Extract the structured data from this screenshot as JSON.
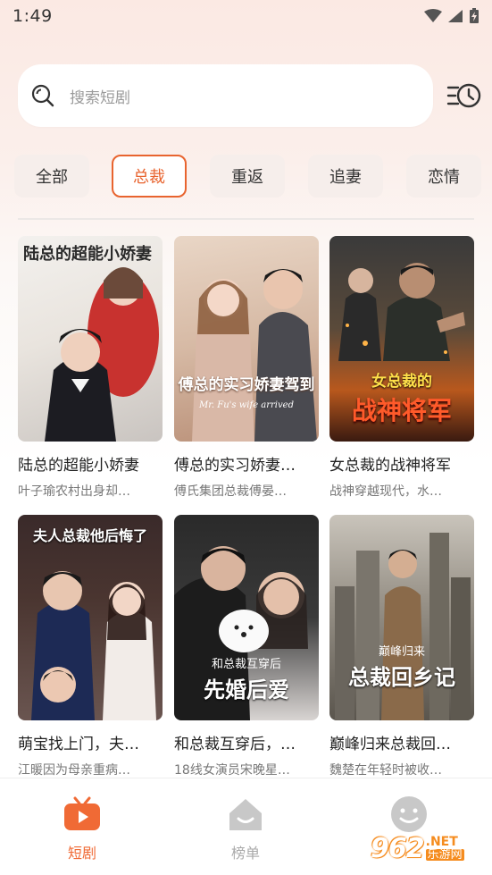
{
  "status_bar": {
    "time": "1:49"
  },
  "search": {
    "placeholder": "搜索短剧"
  },
  "tabs": [
    {
      "label": "全部",
      "active": false
    },
    {
      "label": "总裁",
      "active": true
    },
    {
      "label": "重返",
      "active": false
    },
    {
      "label": "追妻",
      "active": false
    },
    {
      "label": "恋情",
      "active": false
    }
  ],
  "cards": [
    {
      "title": "陆总的超能小娇妻",
      "desc": "叶子瑜农村出身却…",
      "poster_text": "陆总的超能小娇妻"
    },
    {
      "title": "傅总的实习娇妻…",
      "desc": "傅氏集团总裁傅晏…",
      "poster_text": "傅总的实习娇妻驾到",
      "poster_sub": "Mr. Fu's wife arrived"
    },
    {
      "title": "女总裁的战神将军",
      "desc": "战神穿越现代，水…",
      "poster_text_small": "女总裁的",
      "poster_text": "战神将军"
    },
    {
      "title": "萌宝找上门，夫…",
      "desc": "江暖因为母亲重病…",
      "poster_text": "夫人总裁他后悔了"
    },
    {
      "title": "和总裁互穿后，…",
      "desc": "18线女演员宋晚星…",
      "poster_text_small": "和总裁互穿后",
      "poster_text": "先婚后爱"
    },
    {
      "title": "巅峰归来总裁回…",
      "desc": "魏楚在年轻时被收…",
      "poster_text_small": "巅峰归来",
      "poster_text": "总裁回乡记"
    }
  ],
  "bottom_nav": [
    {
      "label": "短剧",
      "icon": "tv-icon",
      "active": true
    },
    {
      "label": "榜单",
      "icon": "house-icon",
      "active": false
    },
    {
      "label": "",
      "icon": "face-icon",
      "active": false
    }
  ],
  "watermark": {
    "num": "962",
    "net": ".NET",
    "cn": "乐游网"
  },
  "colors": {
    "accent": "#e8642f",
    "nav_active": "#f06a35"
  }
}
